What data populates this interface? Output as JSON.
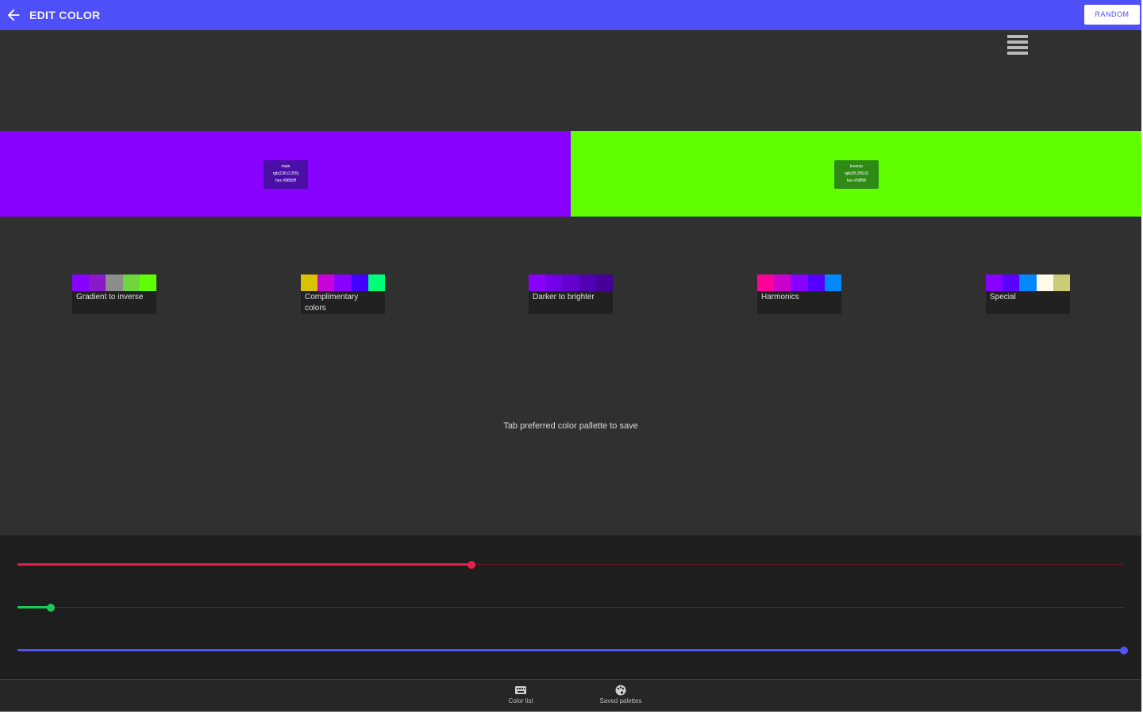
{
  "appbar": {
    "title": "EDIT COLOR",
    "action_label": "RANDOM",
    "back_icon": "arrow-left-icon",
    "background": "#4f4ff9"
  },
  "menu": {
    "icon": "hamburger-menu-icon"
  },
  "swatches": {
    "main": {
      "color": "#8800ff",
      "title": "main",
      "rgb": "rgb(136,0,255)",
      "hex": "hex #8800ff"
    },
    "inverse": {
      "color": "#5fff00",
      "title": "inverse",
      "rgb": "rgb(95,255,0)",
      "hex": "hex #5fff00"
    }
  },
  "palettes": [
    {
      "name": "Gradient to inverse",
      "colors": [
        "#8800ff",
        "#8a1ac9",
        "#8c8c8c",
        "#6fd63c",
        "#5fff00"
      ]
    },
    {
      "name": "Complimentary colors",
      "colors": [
        "#d9c200",
        "#c800d9",
        "#8800ff",
        "#4400ff",
        "#00ff77"
      ]
    },
    {
      "name": "Darker to brighter",
      "colors": [
        "#8800ff",
        "#7300e6",
        "#6200cc",
        "#5200b3",
        "#440099"
      ]
    },
    {
      "name": "Harmonics",
      "colors": [
        "#ff0099",
        "#cc00cc",
        "#8800ff",
        "#5500ff",
        "#0088ff"
      ]
    },
    {
      "name": "Special",
      "colors": [
        "#8800ff",
        "#5b00ff",
        "#0088ff",
        "#fffbe6",
        "#cccc77"
      ]
    }
  ],
  "hint": "Tab preferred color pallette to save",
  "sliders": [
    {
      "name": "red",
      "color": "#e81e4b",
      "track": "#5a1a26",
      "value": 0.41
    },
    {
      "name": "green",
      "color": "#1ec85a",
      "track": "#1f4a2c",
      "value": 0.03
    },
    {
      "name": "blue",
      "color": "#4f55f5",
      "track": "#4f55f5",
      "value": 1.0
    }
  ],
  "bottom_nav": [
    {
      "label": "Color list",
      "icon": "keyboard-icon"
    },
    {
      "label": "Saved palettes",
      "icon": "palette-icon"
    }
  ]
}
